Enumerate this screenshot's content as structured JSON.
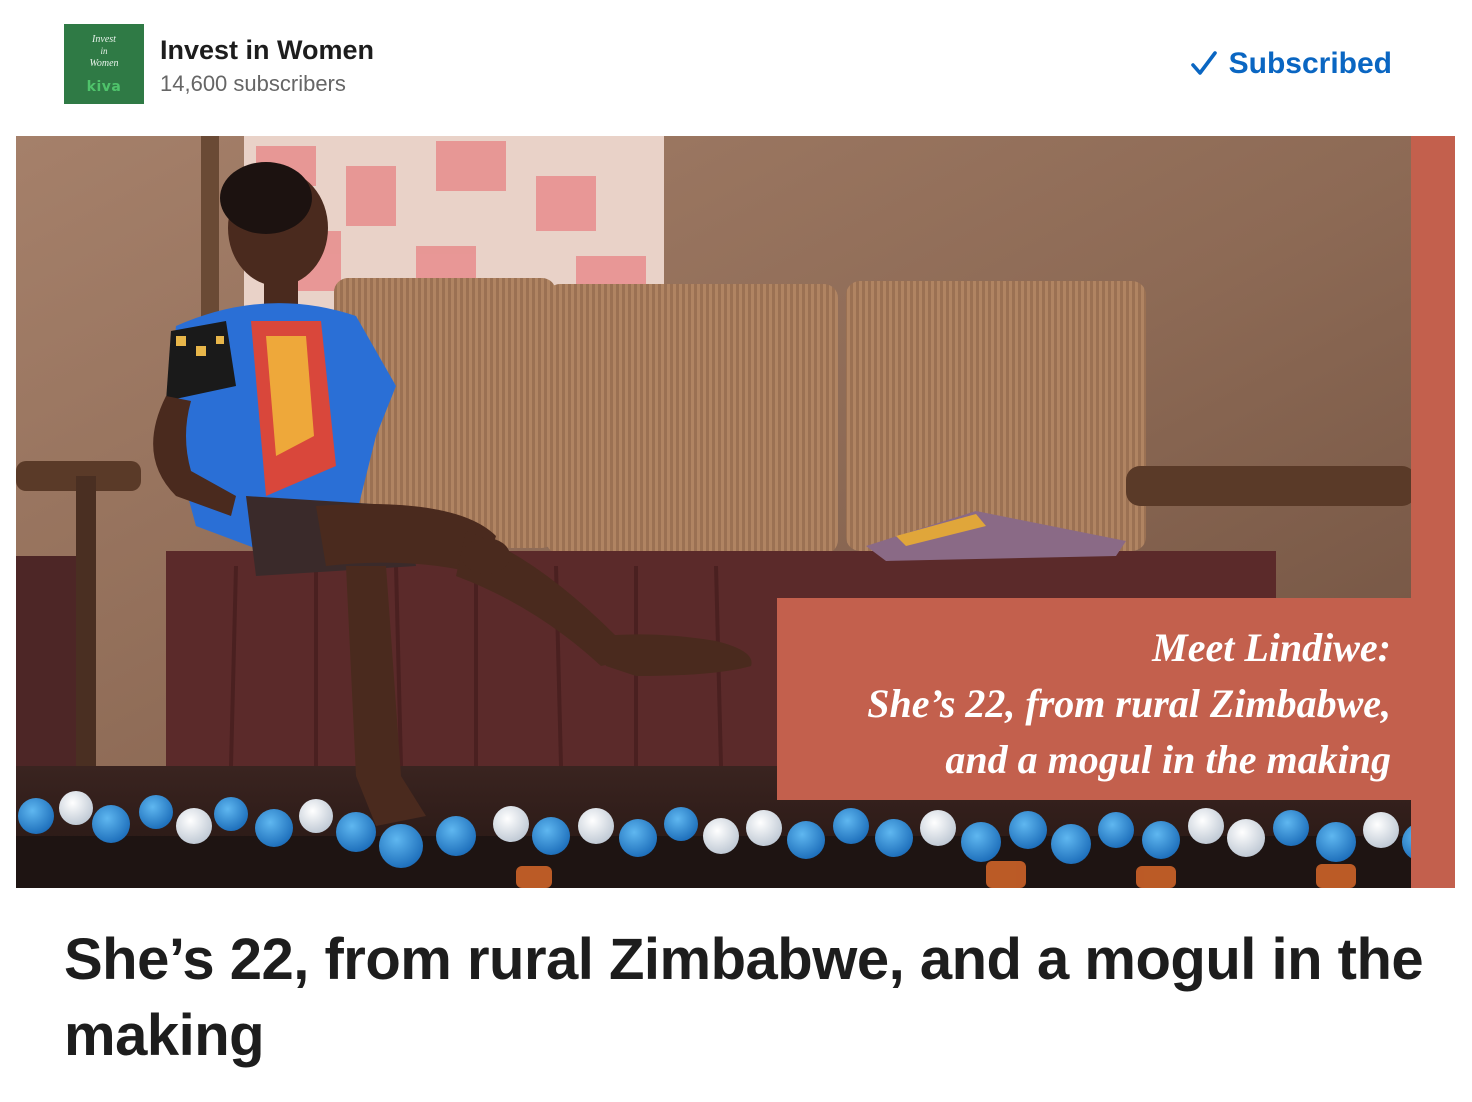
{
  "newsletter": {
    "logo": {
      "line1": "Invest",
      "line2": "in",
      "line3": "Women",
      "brand": "kiva"
    },
    "name": "Invest in Women",
    "subscribers": "14,600 subscribers",
    "subscribe_button": {
      "icon": "checkmark-icon",
      "label": "Subscribed",
      "color": "#0a66c2"
    }
  },
  "hero_image": {
    "overlay_lines": [
      "Meet Lindiwe:",
      "She’s 22, from rural Zimbabwe,",
      "and a mogul in the making"
    ],
    "overlay_color": "#c3604d"
  },
  "article": {
    "title": "She’s 22, from rural Zimbabwe, and a mogul in the making"
  }
}
